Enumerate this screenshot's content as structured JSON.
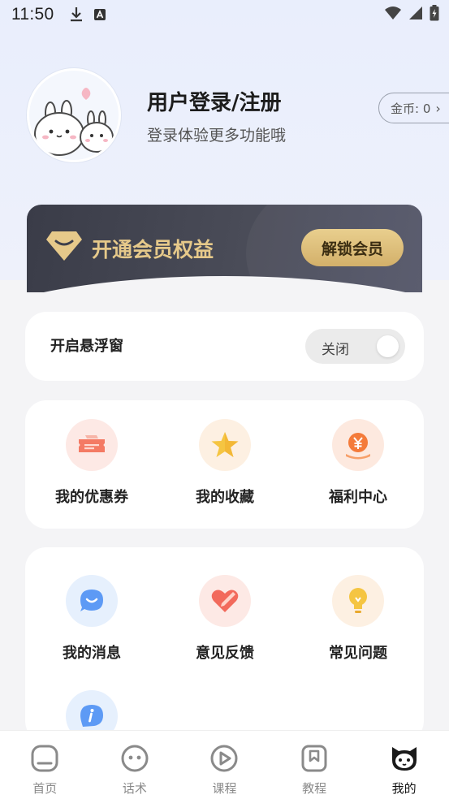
{
  "status_bar": {
    "time": "11:50"
  },
  "profile": {
    "login_title": "用户登录/注册",
    "login_subtitle": "登录体验更多功能哦",
    "coins_label": "金币: 0"
  },
  "vip": {
    "title": "开通会员权益",
    "button_label": "解锁会员",
    "accent_color": "#e6c98a"
  },
  "floating_window": {
    "label": "开启悬浮窗",
    "toggle_state_label": "关闭"
  },
  "grid_section_1": {
    "items": [
      {
        "label": "我的优惠券",
        "icon": "coupon-icon"
      },
      {
        "label": "我的收藏",
        "icon": "star-icon"
      },
      {
        "label": "福利中心",
        "icon": "yuan-coin-icon"
      }
    ]
  },
  "grid_section_2": {
    "items": [
      {
        "label": "我的消息",
        "icon": "message-icon"
      },
      {
        "label": "意见反馈",
        "icon": "feedback-heart-icon"
      },
      {
        "label": "常见问题",
        "icon": "lightbulb-icon"
      },
      {
        "label": "",
        "icon": "info-icon"
      }
    ]
  },
  "tabbar": {
    "tabs": [
      {
        "label": "首页",
        "icon": "home-icon"
      },
      {
        "label": "话术",
        "icon": "chat-face-icon"
      },
      {
        "label": "课程",
        "icon": "play-icon"
      },
      {
        "label": "教程",
        "icon": "bookmark-icon"
      },
      {
        "label": "我的",
        "icon": "cat-face-icon",
        "active": true
      }
    ]
  }
}
